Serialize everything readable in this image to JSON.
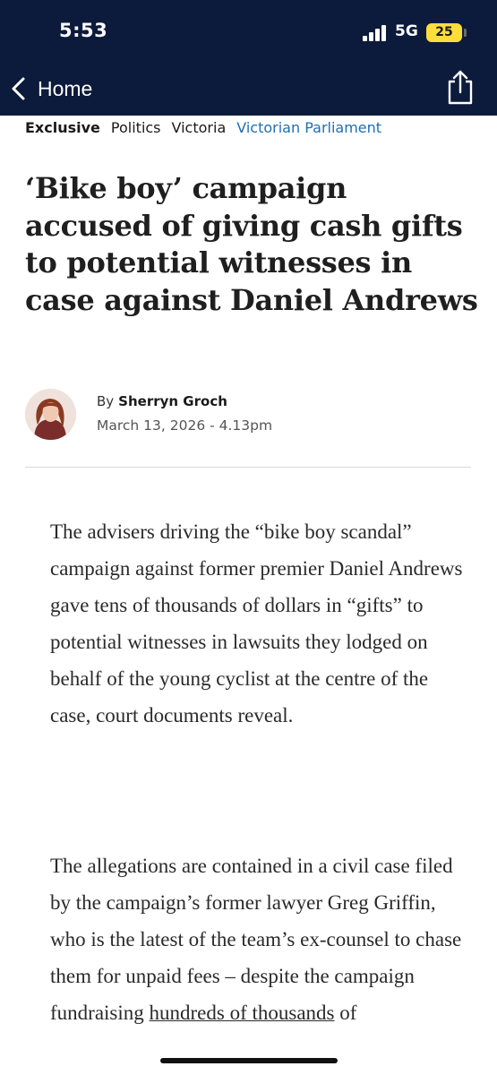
{
  "status_bar": {
    "time": "5:53",
    "network": "5G",
    "battery": "25",
    "signal_icon": "cellular-signal-icon",
    "battery_color": "#ffde3b"
  },
  "nav": {
    "back_label": "Home",
    "back_icon": "chevron-left-icon",
    "share_icon": "share-icon",
    "background_color": "#0c1b3b"
  },
  "tags": {
    "exclusive": "Exclusive",
    "politics": "Politics",
    "victoria": "Victoria",
    "parliament": "Victorian Parliament",
    "link_color": "#1e6fb3"
  },
  "article": {
    "headline": "‘Bike boy’ campaign accused of giving cash gifts to potential witnesses in case against Daniel Andrews",
    "byline_prefix": "By",
    "author": "Sherryn Groch",
    "date": "March 13, 2026 - 4.13pm",
    "paragraph_1": "The advisers driving the “bike boy scandal” campaign against former premier Daniel Andrews gave tens of thousands of dollars in “gifts” to potential witnesses in lawsuits they lodged on behalf of the young cyclist at the centre of the case, court documents reveal.",
    "paragraph_2_start": "The allegations are contained in a civil case filed by the campaign’s former lawyer Greg Griffin, who is the latest of the team’s ex-counsel to chase them for unpaid fees – despite the campaign fundraising ",
    "paragraph_2_link": "hundreds of thousands",
    "paragraph_2_end": " of"
  }
}
